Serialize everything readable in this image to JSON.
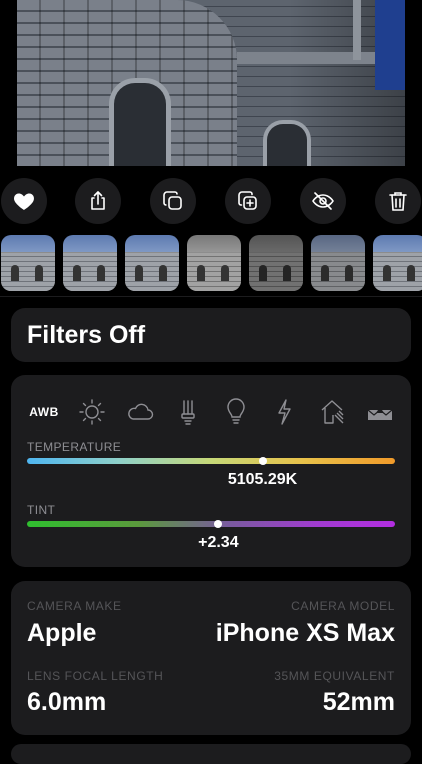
{
  "filters": {
    "title": "Filters Off"
  },
  "white_balance": {
    "presets": [
      {
        "name": "AWB",
        "icon": "awb-text"
      },
      {
        "name": "daylight",
        "icon": "sun-icon"
      },
      {
        "name": "cloudy",
        "icon": "cloud-icon"
      },
      {
        "name": "fluorescent",
        "icon": "fluorescent-icon"
      },
      {
        "name": "tungsten",
        "icon": "bulb-icon"
      },
      {
        "name": "flash",
        "icon": "flash-icon"
      },
      {
        "name": "shade",
        "icon": "shade-icon"
      },
      {
        "name": "underwater",
        "icon": "underwater-icon"
      }
    ],
    "temperature": {
      "label": "TEMPERATURE",
      "value": "5105.29K",
      "level": 0.64
    },
    "tint": {
      "label": "TINT",
      "value": "+2.34",
      "level": 0.52
    }
  },
  "camera": {
    "make_label": "CAMERA MAKE",
    "make": "Apple",
    "model_label": "CAMERA MODEL",
    "model": "iPhone XS Max",
    "focal_label": "LENS FOCAL LENGTH",
    "focal": "6.0mm",
    "equiv_label": "35MM EQUIVALENT",
    "equiv": "52mm"
  },
  "colors": {
    "card": "#1c1c1e",
    "muted": "#8e8e93"
  }
}
